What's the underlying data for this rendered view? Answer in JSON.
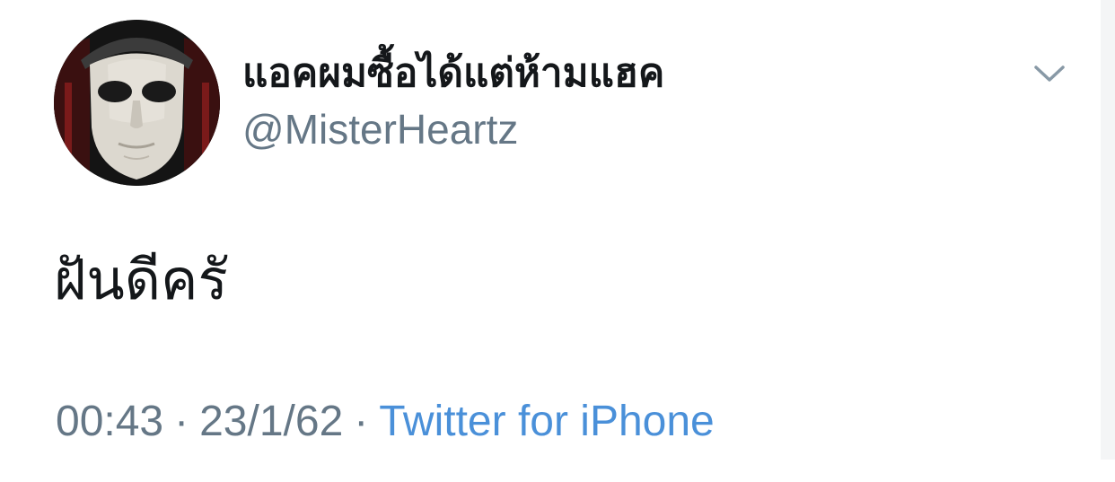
{
  "tweet": {
    "author": {
      "display_name": "แอคผมซื้อได้แต่ห้ามแฮค",
      "handle": "@MisterHeartz"
    },
    "text": "ฝันดีครั",
    "time": "00:43",
    "date": "23/1/62",
    "separator": "·",
    "source": "Twitter for iPhone"
  },
  "icons": {
    "menu": "chevron-down-icon",
    "avatar": "masked-face-avatar"
  },
  "colors": {
    "name": "#14171a",
    "secondary": "#657786",
    "link": "#4a90d9",
    "background": "#ffffff"
  }
}
